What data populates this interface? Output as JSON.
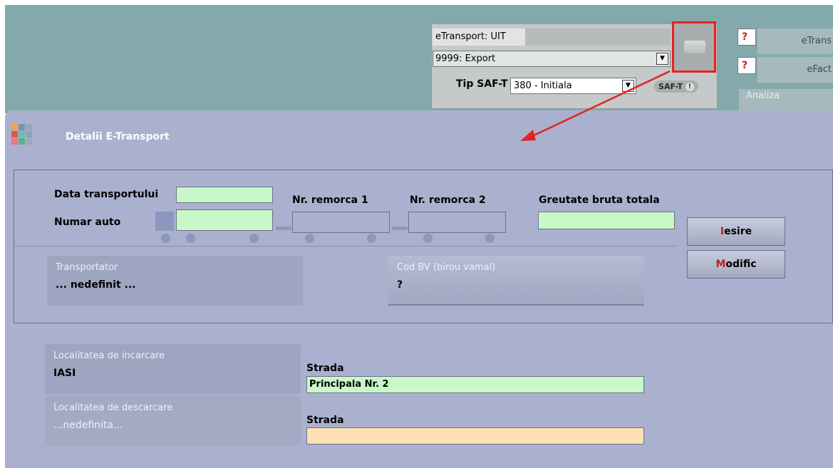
{
  "header": {
    "etransport_label": "eTransport: UIT",
    "export_value": "9999: Export",
    "saft_label": "Tip SAF-T",
    "saft_value": "380 - Initiala",
    "saft_badge": "SAF-T",
    "right_buttons": [
      {
        "q": "?",
        "label": "eTrans"
      },
      {
        "q": "?",
        "label": "eFact"
      }
    ],
    "analiza_label": "Analiza"
  },
  "dialog": {
    "title": "Detalii E-Transport",
    "fields": {
      "data_transportului": {
        "label": "Data transportului",
        "value": ""
      },
      "numar_auto": {
        "label": "Numar auto",
        "value": ""
      },
      "nr_remorca_1": {
        "label": "Nr. remorca 1",
        "value": ""
      },
      "nr_remorca_2": {
        "label": "Nr. remorca 2",
        "value": ""
      },
      "greutate_bruta": {
        "label": "Greutate bruta totala",
        "value": ""
      }
    },
    "buttons": {
      "iesire": {
        "hot": "I",
        "rest": "esire"
      },
      "modific": {
        "hot": "M",
        "rest": "odific"
      }
    },
    "transportator": {
      "caption": "Transportator",
      "value": "... nedefinit ..."
    },
    "cod_bv": {
      "caption": "Cod BV (birou vamal)",
      "value": "?"
    },
    "incarcare": {
      "caption": "Localitatea de incarcare",
      "value": "IASI"
    },
    "strada_incarcare": {
      "label": "Strada",
      "value": "Principala Nr. 2"
    },
    "descarcare": {
      "caption": "Localitatea de descarcare",
      "value": "...nedefinita..."
    },
    "strada_descarcare": {
      "label": "Strada",
      "value": ""
    }
  },
  "colors": {
    "header_bg": "#84a9ad",
    "dialog_bg": "#aab1cf",
    "field_green": "#c8f8c8",
    "field_orange": "#fde1b4",
    "highlight_red": "#e52222"
  }
}
